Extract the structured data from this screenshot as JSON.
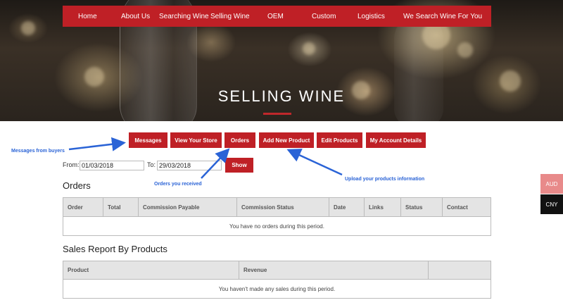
{
  "nav": {
    "items": [
      "Home",
      "About Us",
      "Searching Wine",
      "Selling Wine",
      "OEM",
      "Custom",
      "Logistics",
      "We Search Wine For You"
    ]
  },
  "hero": {
    "title": "SELLING WINE"
  },
  "tabs": [
    "Messages",
    "View Your Store",
    "Orders",
    "Add New Product",
    "Edit Products",
    "My Account Details"
  ],
  "filter": {
    "from_label": "From:",
    "from_value": "01/03/2018",
    "to_label": "To:",
    "to_value": "29/03/2018",
    "show_label": "Show"
  },
  "annotations": {
    "messages": "Messages from buyers",
    "orders": "Orders you received",
    "upload": "Upload your products information"
  },
  "orders": {
    "title": "Orders",
    "columns": [
      "Order",
      "Total",
      "Commission Payable",
      "Commission Status",
      "Date",
      "Links",
      "Status",
      "Contact"
    ],
    "empty": "You have no orders during this period."
  },
  "sales": {
    "title": "Sales Report By Products",
    "columns": [
      "Product",
      "Revenue",
      ""
    ],
    "empty": "You haven't made any sales during this period."
  },
  "currency": {
    "aud": "AUD",
    "cny": "CNY"
  },
  "colors": {
    "brand_red": "#bf2026",
    "annotation_blue": "#2a63d6",
    "aud_bg": "#e88a8a",
    "cny_bg": "#111111"
  }
}
